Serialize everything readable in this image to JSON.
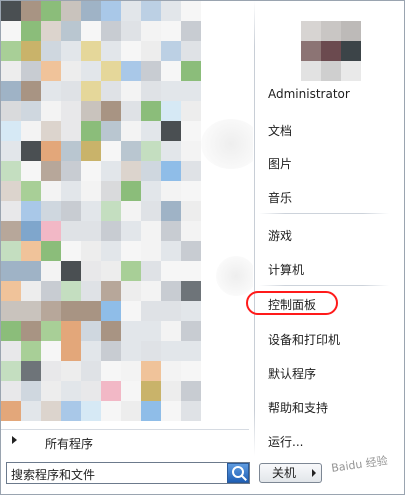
{
  "user": {
    "name": "Administrator"
  },
  "right_menu": [
    {
      "label": "文档"
    },
    {
      "label": "图片"
    },
    {
      "label": "音乐"
    },
    {
      "label": "游戏"
    },
    {
      "label": "计算机"
    },
    {
      "label": "控制面板",
      "annotated": true
    },
    {
      "label": "设备和打印机"
    },
    {
      "label": "默认程序"
    },
    {
      "label": "帮助和支持"
    },
    {
      "label": "运行..."
    }
  ],
  "programs": {
    "all_programs_label": "所有程序"
  },
  "search": {
    "placeholder": "搜索程序和文件"
  },
  "shutdown": {
    "label": "关机"
  },
  "colors": {
    "annotation": "#ff1a1a",
    "search_button": "#2f6fc4"
  }
}
